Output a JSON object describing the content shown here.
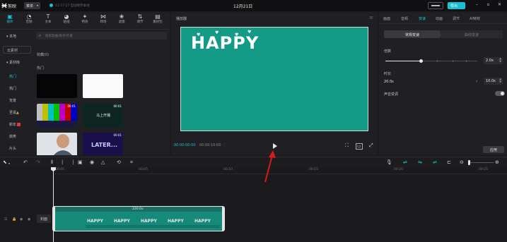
{
  "app": {
    "name": "剪映",
    "menu_label": "菜单",
    "autosave_text": "11:17:27 自动保存本地",
    "project_title": "12月21日",
    "share_label": "导出"
  },
  "toolbar": {
    "items": [
      {
        "label": "媒体",
        "icon": "media-icon"
      },
      {
        "label": "音频",
        "icon": "audio-icon"
      },
      {
        "label": "文本",
        "icon": "text-icon"
      },
      {
        "label": "贴纸",
        "icon": "sticker-icon"
      },
      {
        "label": "特效",
        "icon": "effects-icon"
      },
      {
        "label": "转场",
        "icon": "transition-icon"
      },
      {
        "label": "滤镜",
        "icon": "filter-icon"
      },
      {
        "label": "调节",
        "icon": "adjust-icon"
      },
      {
        "label": "素材包",
        "icon": "package-icon"
      }
    ]
  },
  "sidebar": {
    "items": [
      {
        "label": "▾ 本地"
      },
      {
        "label": "云素材"
      },
      {
        "label": "▾ 素材库"
      },
      {
        "label": "热门"
      },
      {
        "label": "热门"
      },
      {
        "label": "背景"
      },
      {
        "label": "圣诞"
      },
      {
        "label": "新年"
      },
      {
        "label": "搞笑"
      },
      {
        "label": "片头"
      }
    ]
  },
  "library": {
    "search_placeholder": "搜索歌曲/歌手/元素",
    "section_title": "收藏(0)",
    "subsection_title": "热门",
    "thumb_labels": [
      "00:01",
      "00:01",
      "马上开播",
      "00:01",
      "LATER..."
    ]
  },
  "player": {
    "title": "播放器",
    "canvas_text": "HAPPY",
    "time_current": "00:00:00:00",
    "time_total": "00:00:10:00",
    "canvas_color": "#149b88"
  },
  "right_panel": {
    "tabs": [
      "画面",
      "音频",
      "变速",
      "动画",
      "调节",
      "AI特效"
    ],
    "active_tab": 2,
    "segments": [
      "常规变速",
      "曲线变速"
    ],
    "speed_label": "倍数",
    "speed_value": "2.0x",
    "duration_label": "时长",
    "duration_from": "20.0s",
    "duration_value": "10.0s",
    "pitch_label": "声音变调",
    "apply_label": "应用"
  },
  "timeline": {
    "ruler": [
      "00:00",
      "00:05",
      "00:10",
      "00:15",
      "00:20",
      "00:25"
    ],
    "clip_duration": "220.0x",
    "cover_label": "封面",
    "accent_color": "#17c2d3"
  }
}
